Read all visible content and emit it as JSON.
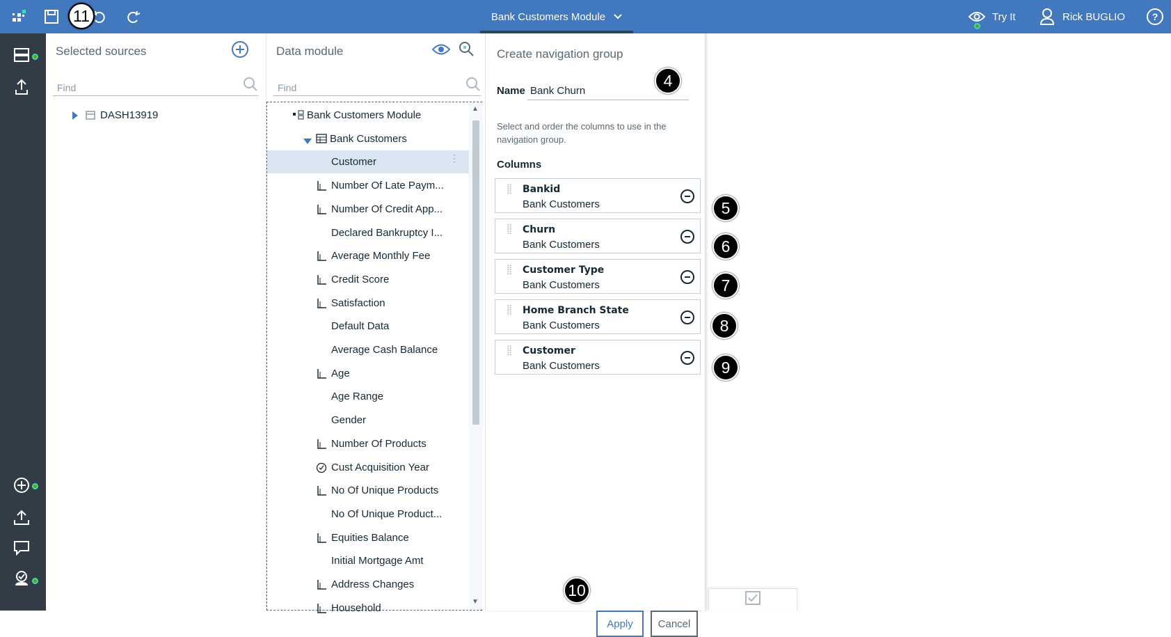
{
  "topbar": {
    "module_title": "Bank Customers Module",
    "tryit_label": "Try It",
    "user_name": "Rick BUGLIO",
    "help_label": "?"
  },
  "markers": {
    "m4": "4",
    "m5": "5",
    "m6": "6",
    "m7": "7",
    "m8": "8",
    "m9": "9",
    "m10": "10",
    "m11": "11"
  },
  "sources": {
    "title": "Selected sources",
    "find_placeholder": "Find",
    "items": [
      {
        "label": "DASH13919",
        "icon": "database-table-icon"
      }
    ]
  },
  "datamodule": {
    "title": "Data module",
    "find_placeholder": "Find",
    "rows": [
      {
        "label": "Bank Customers Module",
        "icon": "module-icon"
      },
      {
        "label": "Bank Customers",
        "icon": "table-icon"
      },
      {
        "label": "Customer",
        "icon": ""
      },
      {
        "label": "Number Of Late Paym...",
        "icon": "measure-icon"
      },
      {
        "label": "Number Of Credit App...",
        "icon": "measure-icon"
      },
      {
        "label": "Declared Bankruptcy I...",
        "icon": ""
      },
      {
        "label": "Average Monthly Fee",
        "icon": "measure-icon"
      },
      {
        "label": "Credit Score",
        "icon": "measure-icon"
      },
      {
        "label": "Satisfaction",
        "icon": "measure-icon"
      },
      {
        "label": "Default Data",
        "icon": ""
      },
      {
        "label": "Average Cash Balance",
        "icon": ""
      },
      {
        "label": "Age",
        "icon": "measure-icon"
      },
      {
        "label": "Age Range",
        "icon": ""
      },
      {
        "label": "Gender",
        "icon": ""
      },
      {
        "label": "Number Of Products",
        "icon": "measure-icon"
      },
      {
        "label": "Cust Acquisition Year",
        "icon": "clock-icon"
      },
      {
        "label": "No Of Unique Products",
        "icon": "measure-icon"
      },
      {
        "label": "No Of Unique Product...",
        "icon": ""
      },
      {
        "label": "Equities Balance",
        "icon": "measure-icon"
      },
      {
        "label": "Initial Mortgage Amt",
        "icon": ""
      },
      {
        "label": "Address Changes",
        "icon": "measure-icon"
      },
      {
        "label": "Household",
        "icon": "measure-icon"
      }
    ]
  },
  "navgroup": {
    "title": "Create navigation group",
    "name_label": "Name",
    "name_value": "Bank Churn",
    "description": "Select and order the columns to use in the navigation group.",
    "columns_label": "Columns",
    "columns": [
      {
        "name": "Bankid",
        "source": "Bank Customers"
      },
      {
        "name": "Churn",
        "source": "Bank Customers"
      },
      {
        "name": "Customer Type",
        "source": "Bank Customers"
      },
      {
        "name": "Home Branch State",
        "source": "Bank Customers"
      },
      {
        "name": "Customer",
        "source": "Bank Customers"
      }
    ],
    "apply_label": "Apply",
    "cancel_label": "Cancel"
  },
  "colors": {
    "topbar": "#4178be",
    "rail": "#323c47",
    "selected_row": "#dbe6f3",
    "accent": "#4178be"
  }
}
